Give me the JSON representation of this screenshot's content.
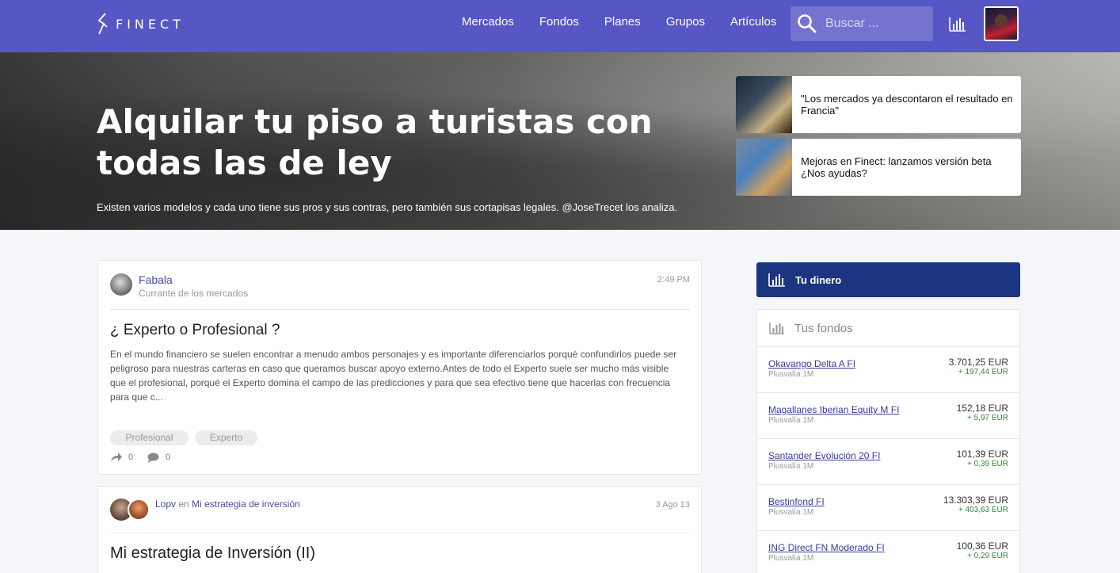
{
  "navbar": {
    "brand": "FINECT",
    "links": [
      "Mercados",
      "Fondos",
      "Planes",
      "Grupos",
      "Artículos"
    ],
    "search_placeholder": "Buscar ..."
  },
  "hero": {
    "title": "Alquilar tu piso a turistas con todas las de ley",
    "subtitle": "Existen varios modelos y cada uno tiene sus pros y sus contras, pero también sus cortapisas legales. @JoseTrecet los analiza.",
    "cards": [
      {
        "text": "\"Los mercados ya descontaron el resultado en Francia\""
      },
      {
        "text": "Mejoras en Finect: lanzamos versión beta ¿Nos ayudas?"
      }
    ]
  },
  "posts": [
    {
      "author": "Fabala",
      "role": "Currante de los mercados",
      "time": "2:49 PM",
      "title": "¿ Experto o Profesional ?",
      "body": "En el mundo financiero se suelen encontrar a menudo ambos personajes y es importante diferenciarlos porqué confundirlos puede ser peligroso para nuestras carteras en caso que queramos buscar apoyo externo.Antes de todo el Experto suele ser mucho más visible que el profesional, porqué el Experto domina el campo de las predicciones y para que sea efectivo tiene que hacerlas con frecuencia para que c...",
      "tags": [
        "Profesional",
        "Experto"
      ],
      "shares": "0",
      "comments": "0"
    },
    {
      "author": "Lopv",
      "connector": "en",
      "group": "Mi estrategia de inversión",
      "time": "3 Ago 13",
      "title": "Mi estrategia de Inversión (II)"
    }
  ],
  "sidebar": {
    "tu_dinero": "Tu dinero",
    "fondos_title": "Tus fondos",
    "fondos": [
      {
        "name": "Okavango Delta A FI",
        "sub": "Plusvalía 1M",
        "value": "3.701,25 EUR",
        "delta": "+ 197,44 EUR"
      },
      {
        "name": "Magallanes Iberian Equity M FI",
        "sub": "Plusvalía 1M",
        "value": "152,18 EUR",
        "delta": "+ 5,97 EUR"
      },
      {
        "name": "Santander Evolución 20 FI",
        "sub": "Plusvalía 1M",
        "value": "101,39 EUR",
        "delta": "+ 0,39 EUR"
      },
      {
        "name": "Bestinfond FI",
        "sub": "Plusvalía 1M",
        "value": "13.303,39 EUR",
        "delta": "+ 403,63 EUR"
      },
      {
        "name": "ING Direct FN Moderado FI",
        "sub": "Plusvalía 1M",
        "value": "100,36 EUR",
        "delta": "+ 0,29 EUR"
      }
    ]
  },
  "colors": {
    "navbar": "#5656c4",
    "tu_dinero": "#1b3580",
    "link": "#4a4aa8",
    "positive": "#2e8b3a"
  },
  "icons": [
    "finect-logo-icon",
    "search-icon",
    "chart-icon",
    "share-icon",
    "comment-icon"
  ]
}
